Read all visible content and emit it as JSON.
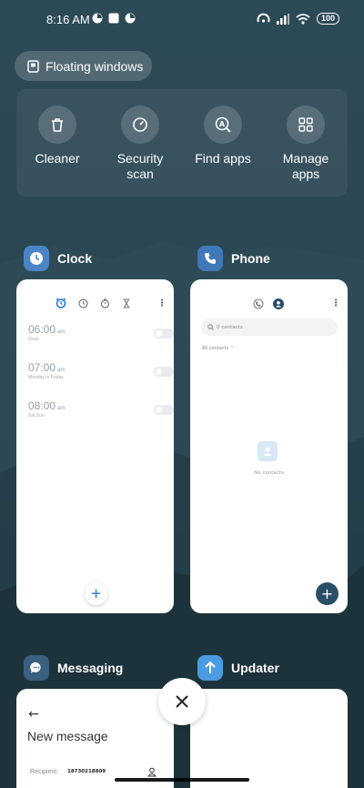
{
  "status": {
    "time": "8:16 AM",
    "battery": "100"
  },
  "floating": {
    "label": "Floating windows"
  },
  "tools": [
    {
      "label": "Cleaner",
      "icon": "trash-icon"
    },
    {
      "label": "Security scan",
      "icon": "security-gauge-icon"
    },
    {
      "label": "Find apps",
      "icon": "find-apps-icon"
    },
    {
      "label": "Manage apps",
      "icon": "grid-icon"
    }
  ],
  "apps": {
    "clock": {
      "name": "Clock",
      "alarms": [
        {
          "time": "06:00",
          "ampm": "am",
          "sub": "Once"
        },
        {
          "time": "07:00",
          "ampm": "am",
          "sub": "Monday to Friday"
        },
        {
          "time": "08:00",
          "ampm": "am",
          "sub": "Sat Sun"
        }
      ],
      "add_label": "+"
    },
    "phone": {
      "name": "Phone",
      "search_placeholder": "0 contacts",
      "filter": "All contacts",
      "empty_label": "No contacts",
      "add_label": "+"
    },
    "messaging": {
      "name": "Messaging",
      "title": "New message",
      "recipient_label": "Recipient:",
      "recipient_number": "18730218809"
    },
    "updater": {
      "name": "Updater"
    }
  },
  "colors": {
    "clock_icon": "#4a84c4",
    "phone_icon": "#3f78b6",
    "messaging_icon": "#3b5f7e",
    "updater_icon": "#4b9be0",
    "phone_fab": "#2a4e68"
  }
}
